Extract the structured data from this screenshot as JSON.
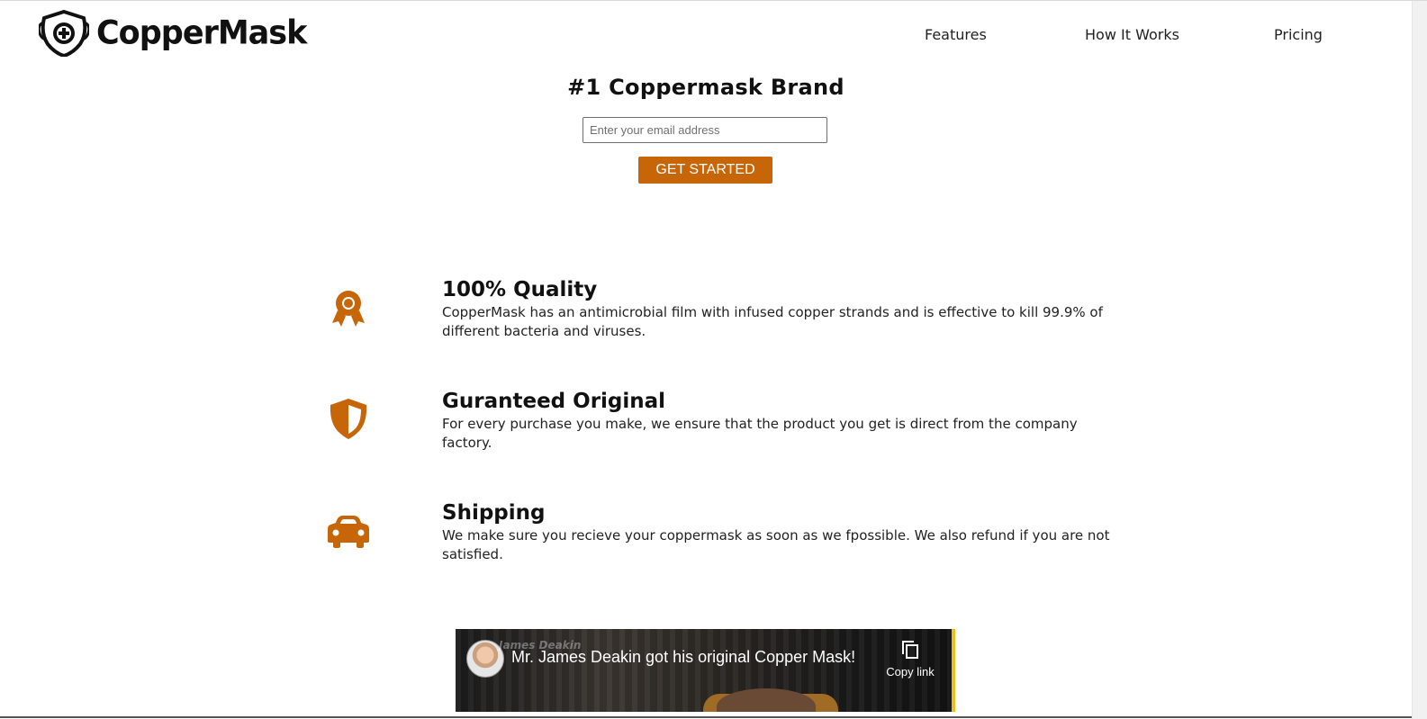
{
  "brand": {
    "name": "CopperMask",
    "accent_color": "#c66608",
    "logo_icon": "shield-plus-icon"
  },
  "nav": {
    "items": [
      {
        "label": "Features"
      },
      {
        "label": "How It Works"
      },
      {
        "label": "Pricing"
      }
    ]
  },
  "hero": {
    "title": "#1 Coppermask Brand",
    "email_placeholder": "Enter your email address",
    "email_value": "",
    "cta_label": "GET STARTED"
  },
  "features": [
    {
      "icon": "award-ribbon-icon",
      "title": "100% Quality",
      "text": "CopperMask has an antimicrobial film with infused copper strands and is effective to kill 99.9% of different bacteria and viruses."
    },
    {
      "icon": "shield-half-icon",
      "title": "Guranteed Original",
      "text": "For every purchase you make, we ensure that the product you get is direct from the company factory."
    },
    {
      "icon": "car-icon",
      "title": "Shipping",
      "text": "We make sure you recieve your coppermask as soon as we fpossible. We also refund if you are not satisfied."
    }
  ],
  "video": {
    "title": "Mr. James Deakin got his original Copper Mask!",
    "channel_watermark": "James Deakin",
    "copy_label": "Copy link",
    "copy_icon": "copy-icon"
  }
}
